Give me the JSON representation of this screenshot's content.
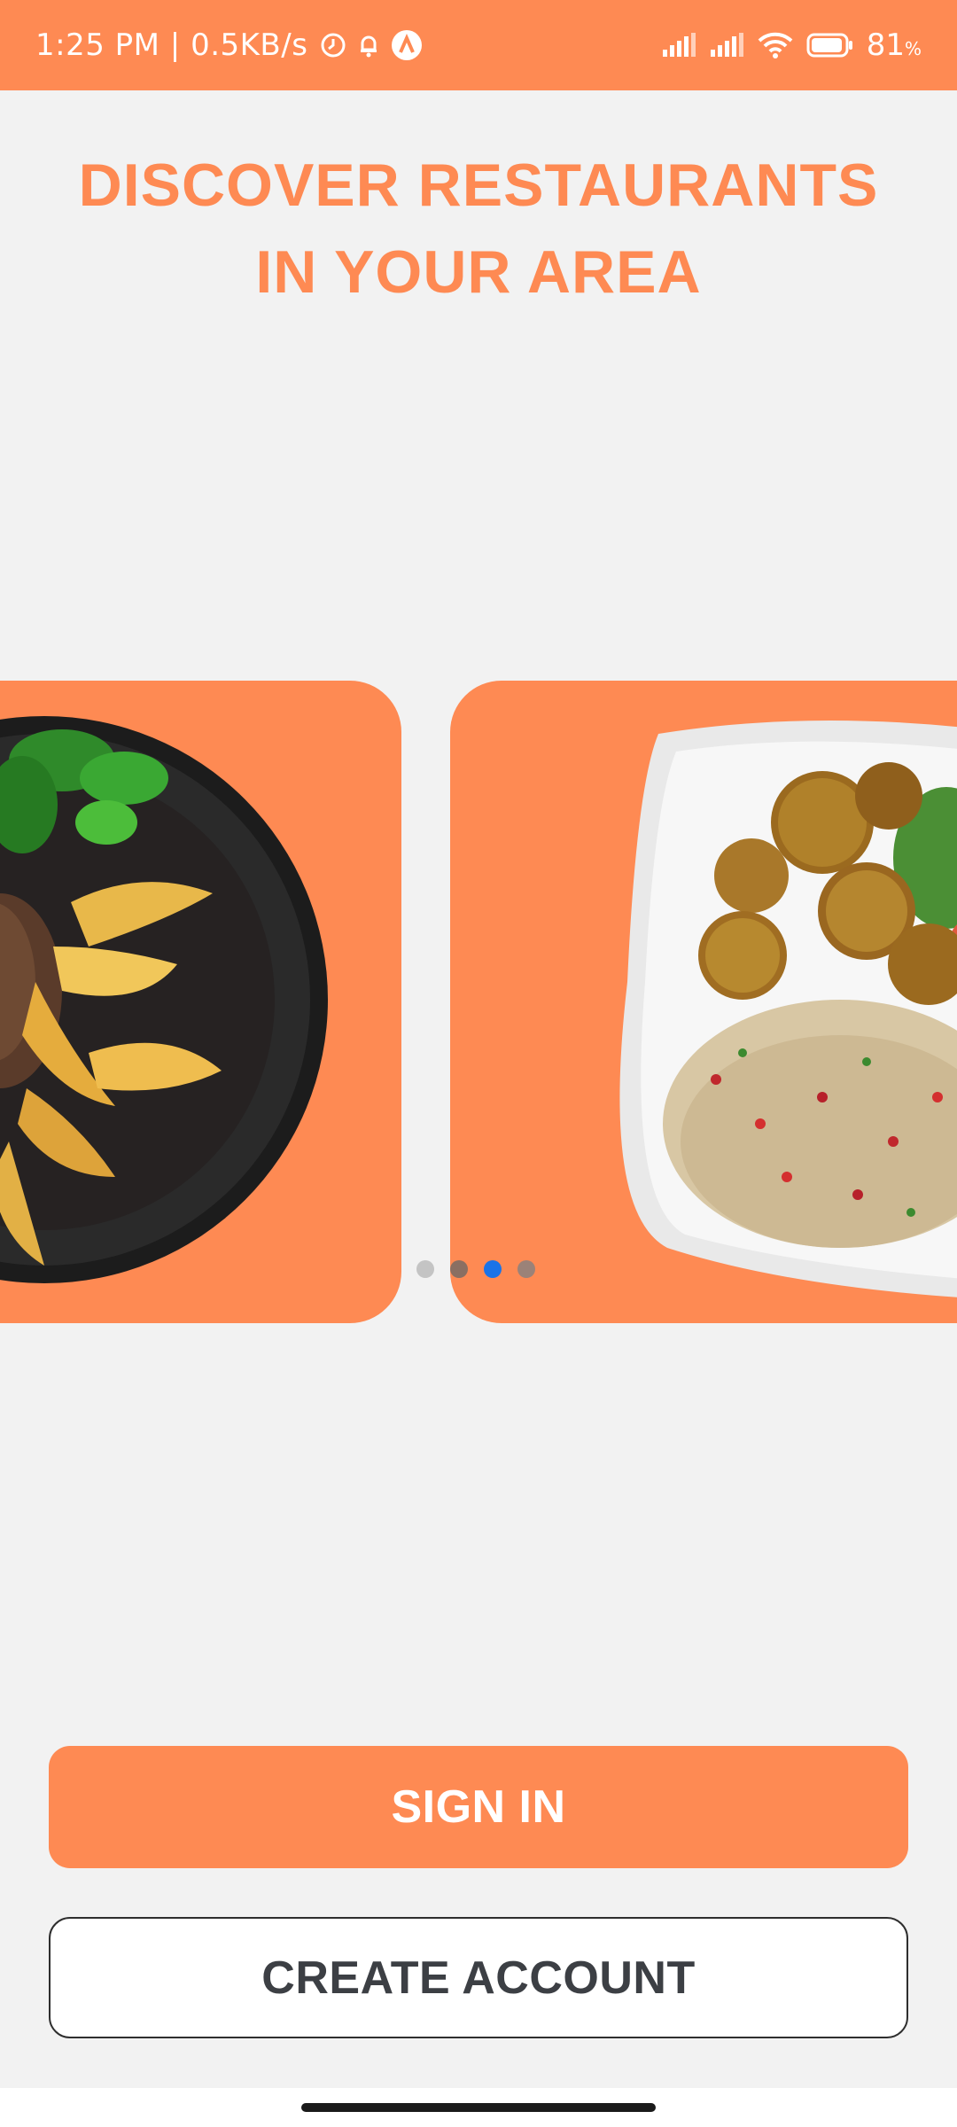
{
  "status_bar": {
    "time": "1:25 PM | 0.5KB/s",
    "battery_percent": "81",
    "battery_unit": "%",
    "icons": [
      "clock-icon",
      "bell-icon",
      "app-a-icon",
      "signal-icon",
      "signal-icon",
      "wifi-icon",
      "battery-icon"
    ]
  },
  "headline": {
    "line1": "DISCOVER RESTAURANTS",
    "line2": "IN YOUR AREA"
  },
  "carousel": {
    "slide_count": 4,
    "active_index": 2,
    "colors": {
      "card": "#fe8a53",
      "dot_active": "#1a73e8",
      "dot_inactive": "#bdbdbd",
      "dot_dim": "#8a6f62"
    }
  },
  "buttons": {
    "sign_in": "SIGN IN",
    "create_account": "CREATE ACCOUNT"
  },
  "colors": {
    "brand": "#fe8a53",
    "background": "#f2f2f2",
    "dark_text": "#3c3f44"
  }
}
